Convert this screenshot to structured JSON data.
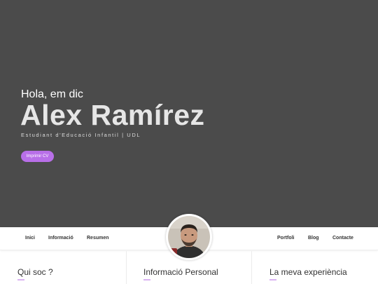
{
  "hero": {
    "greeting": "Hola, em dic",
    "name": "Alex Ramírez",
    "subtitle": "Estudiant d'Educació Infantil | UDL",
    "cv_button_label": "Imprimir CV"
  },
  "nav": {
    "left": [
      "Inici",
      "Informació",
      "Resumen"
    ],
    "right": [
      "Portfoli",
      "Blog",
      "Contacte"
    ]
  },
  "sections": [
    {
      "title": "Qui soc ?"
    },
    {
      "title": "Informació Personal"
    },
    {
      "title": "La meva experiència"
    }
  ],
  "colors": {
    "hero_bg": "#4b4b4b",
    "accent": "#b86fe8",
    "accent_light": "#d9b3f2"
  }
}
